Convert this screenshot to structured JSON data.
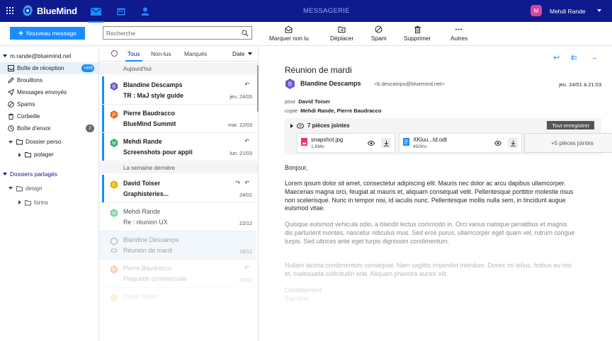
{
  "topbar": {
    "logo_text": "BlueMind",
    "app_title": "MESSAGERIE",
    "user_initial": "M",
    "user_name": "Mehdi Rande",
    "colors": {
      "bar": "#0e1a8e",
      "accent": "#1a8cff"
    }
  },
  "toolbar": {
    "new_message": "Nouveau message",
    "search_placeholder": "Recherche",
    "actions": {
      "mark_unread": "Marquer non lu",
      "move": "Déplacer",
      "spam": "Spam",
      "delete": "Supprimer",
      "more": "Autres"
    }
  },
  "sidebar": {
    "account": "m.rande@bluemind.net",
    "inbox": {
      "label": "Boîte de réception",
      "badge": "+999"
    },
    "drafts": "Brouillons",
    "sent": "Messages envoyés",
    "spam": "Spams",
    "trash": "Corbeille",
    "outbox": {
      "label": "Boîte d'envoi",
      "badge": "2"
    },
    "personal_folder": "Dossier perso",
    "personal_sub": "potager",
    "shared_title": "Dossiers partagés",
    "shared_folder": "design",
    "shared_sub": "forms"
  },
  "message_list": {
    "tabs": {
      "all": "Tous",
      "unread": "Non-lus",
      "flagged": "Marqués"
    },
    "sort": "Date",
    "group_today": "Aujourd'hui",
    "group_last_week": "La semaine dernière",
    "rows": [
      {
        "initial": "B",
        "from": "Blandine Descamps",
        "subject": "TR : MaJ style guide",
        "date": "jeu. 24/03",
        "flag": "↶",
        "avatar_color": "#6a5acd"
      },
      {
        "initial": "P",
        "from": "Pierre Baudracco",
        "subject": "BlueMind Summit",
        "date": "mar. 22/03",
        "flag": "",
        "avatar_color": "#f26b21"
      },
      {
        "initial": "M",
        "from": "Mehdi Rande",
        "subject": "Screenshots pour appli",
        "date": "lun. 21/03",
        "flag": "↶",
        "avatar_color": "#2fb36a"
      },
      {
        "initial": "D",
        "from": "David Toiser",
        "subject": "Graphisteries...",
        "date": "24/01",
        "flag": "↷ ↶",
        "avatar_color": "#e8b400"
      },
      {
        "initial": "M",
        "from": "Mehdi Rande",
        "subject": "Re : réunion UX",
        "date": "22/12",
        "flag": "",
        "avatar_color": "#2fb36a"
      },
      {
        "initial": "",
        "from": "Blandine Descamps",
        "subject": "Réunion de mardi",
        "date": "19/12",
        "flag": "",
        "avatar_color": "#aaaaaa"
      },
      {
        "initial": "P",
        "from": "Pierre Baudracco",
        "subject": "Plaquette commerciale",
        "date": "13/12",
        "flag": "↶",
        "avatar_color": "#f26b21"
      },
      {
        "initial": "",
        "from": "David Toiser",
        "subject": "",
        "date": "",
        "flag": "",
        "avatar_color": "#e8b400"
      }
    ]
  },
  "reader": {
    "subject": "Réunion de mardi",
    "from_initial": "B",
    "from_name": "Blandine Descamps",
    "from_email": "<b.descamps@bluemind.net>",
    "date": "jeu. 24/01 à 21:03",
    "to_label": "pour",
    "to_value": "David Toiser",
    "cc_label": "copie",
    "cc_value": "Mehdi Rande, Pierre Baudracco",
    "attachments": {
      "header": "7 pièces jointes",
      "save_all": "Tout enregistrer",
      "files": [
        {
          "name": "snapshot.jpg",
          "size": "1,8Mo",
          "color": "#e8336b"
        },
        {
          "name": "XKluu...td.odt",
          "size": "450Ko",
          "color": "#1a8cff"
        }
      ],
      "more": "+5 pièces jointes"
    },
    "greeting": "Bonjour,",
    "paragraph1": "Lorem ipsum dolor sit amet, consectetur adipiscing elit. Mauris nec dolor ac arcu dapibus ullamcorper. Maecenas magna orci, feugiat at mauris et, aliquam consequat velit. Pellentesque porttitor molestie risus non scelerisque. Nunc in tempor nisi, id iaculis nunc. Pellentesque mollis nulla sem, in tincidunt augue euismod vitae.",
    "paragraph2": "Quisque euismod vehicula odio, a blandit lectus commodo in. Orci varius natoque penatibus et magnis dis parturient montes, nascetur ridiculus mus. Sed eros purus, ullamcorper eget quam vel, rutrum congue turpis. Sed ultrices ante eget turpis dignissim condimentum.",
    "paragraph3": "Nullam lacinia condimentum consequat. Nam sagittis imperdiet interdum. Donec mi tellus, finibus eu nisi et, malesuada sollicitudin erat. Aliquam pharetra auctor elit.",
    "closing": "Cordialement",
    "signature": "Blandine"
  }
}
